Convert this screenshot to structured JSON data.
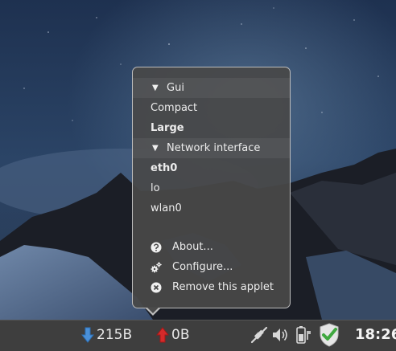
{
  "menu": {
    "section_gui": "Gui",
    "compact": "Compact",
    "large": "Large",
    "section_network": "Network interface",
    "eth0": "eth0",
    "lo": "lo",
    "wlan0": "wlan0",
    "about": "About...",
    "configure": "Configure...",
    "remove": "Remove this applet"
  },
  "panel": {
    "download": "215B",
    "upload": "0B",
    "clock": "18:26"
  },
  "colors": {
    "download_arrow": "#4a90d9",
    "upload_arrow": "#d42a2a",
    "shield_check": "#3fa83f"
  }
}
